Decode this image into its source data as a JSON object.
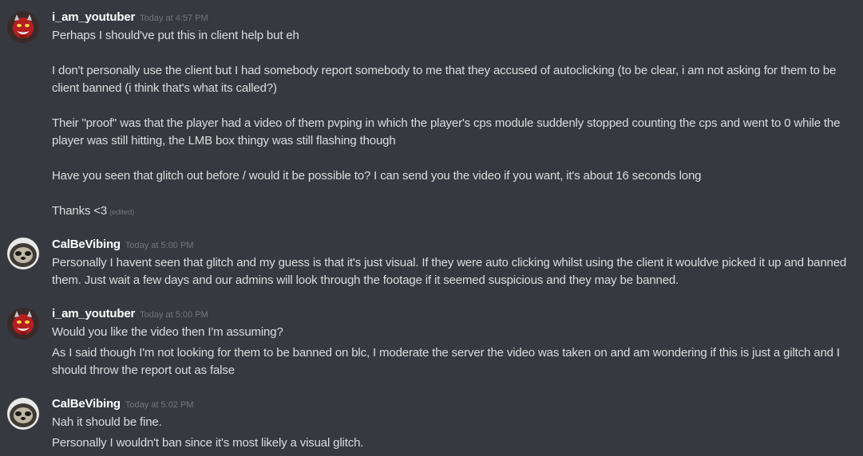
{
  "messages": [
    {
      "username": "i_am_youtuber",
      "timestamp": "Today at 4:57 PM",
      "lines": [
        "Perhaps I should've put this in client help but eh",
        "I don't personally use the client but I had somebody report somebody to me that they accused of autoclicking (to be clear, i am not asking for them to be client banned (i think that's what its called?)",
        "Their \"proof\" was that the player had a video of them pvping in which the player's cps module suddenly stopped counting the cps and went to 0 while the player was still hitting, the LMB box thingy was still flashing though",
        "Have you seen that glitch out before / would it be possible to? I can send you the video if you want, it's about 16 seconds long",
        "Thanks <3"
      ],
      "edited_label": "(edited)"
    },
    {
      "username": "CalBeVibing",
      "timestamp": "Today at 5:00 PM",
      "lines": [
        "Personally I havent seen that glitch and my guess is that it's just visual. If they were auto clicking whilst using the client it wouldve picked it up and banned them. Just wait a few days and our admins will look through the footage if it seemed suspicious and they may be banned."
      ]
    },
    {
      "username": "i_am_youtuber",
      "timestamp": "Today at 5:00 PM",
      "lines": [
        "Would you like the video then I'm assuming?",
        "As I said though I'm not looking for them to be banned on blc, I moderate the server the video was taken on and am wondering if this is just a giltch and I should throw the report out as false"
      ]
    },
    {
      "username": "CalBeVibing",
      "timestamp": "Today at 5:02 PM",
      "lines": [
        "Nah it should be fine.",
        "Personally I wouldn't ban since it's most likely a visual glitch."
      ]
    }
  ],
  "colors": {
    "background": "#36393f",
    "username": "#ffffff",
    "message_text": "#dcddde",
    "timestamp": "#72767d"
  },
  "icons": {
    "avatar_1": "red-devil-avatar-icon",
    "avatar_2": "sloth-avatar-icon"
  }
}
